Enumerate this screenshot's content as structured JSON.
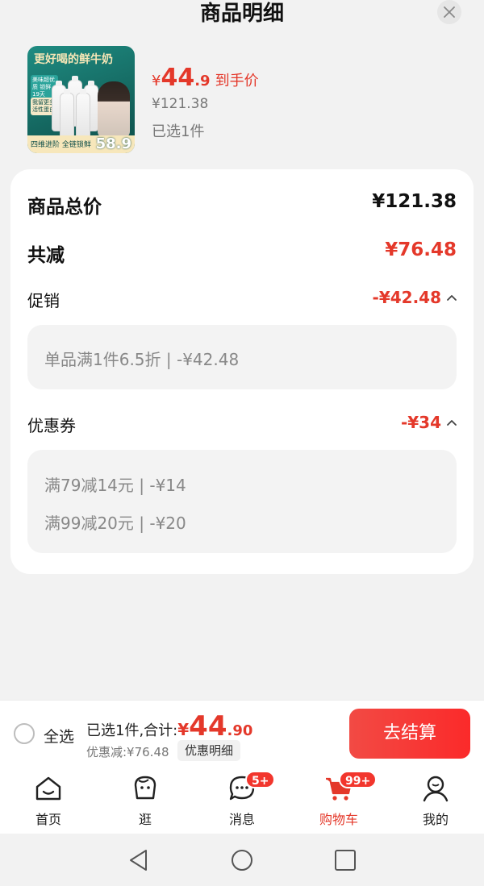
{
  "sheet": {
    "title": "商品明细"
  },
  "product": {
    "thumb": {
      "headline": "更好喝的鲜牛奶",
      "chip1": "美味超优质 锁鲜19天",
      "chip2": "我留更多 活性蛋白",
      "footer": "四维进阶 全链锁鲜",
      "price": "58.9"
    },
    "price_yen": "¥",
    "price_int": "44",
    "price_dec": ".9",
    "price_label": "到手价",
    "original_price": "¥121.38",
    "selected": "已选1件"
  },
  "detail": {
    "total_label": "商品总价",
    "total_value": "¥121.38",
    "reduce_label": "共减",
    "reduce_value": "¥76.48",
    "promo": {
      "label": "促销",
      "value": "-¥42.48",
      "items": [
        "单品满1件6.5折 | -¥42.48"
      ]
    },
    "coupon": {
      "label": "优惠券",
      "value": "-¥34",
      "items": [
        "满79减14元 | -¥14",
        "满99减20元 | -¥20"
      ]
    }
  },
  "checkout": {
    "select_all": "全选",
    "summary_prefix": "已选1件,合计:",
    "total_yen": "¥",
    "total_int": "44",
    "total_dec": ".90",
    "discount": "优惠减:¥76.48",
    "detail_tag": "优惠明细",
    "pay_button": "去结算"
  },
  "tabs": [
    {
      "label": "首页",
      "icon": "home-icon"
    },
    {
      "label": "逛",
      "icon": "browse-icon"
    },
    {
      "label": "消息",
      "icon": "message-icon",
      "badge": "5+"
    },
    {
      "label": "购物车",
      "icon": "cart-icon",
      "badge": "99+",
      "active": true
    },
    {
      "label": "我的",
      "icon": "profile-icon"
    }
  ],
  "colors": {
    "accent": "#e4382a",
    "pay_button": "#f8312f",
    "card_bg": "#ffffff",
    "page_bg": "#f2f2f2"
  }
}
